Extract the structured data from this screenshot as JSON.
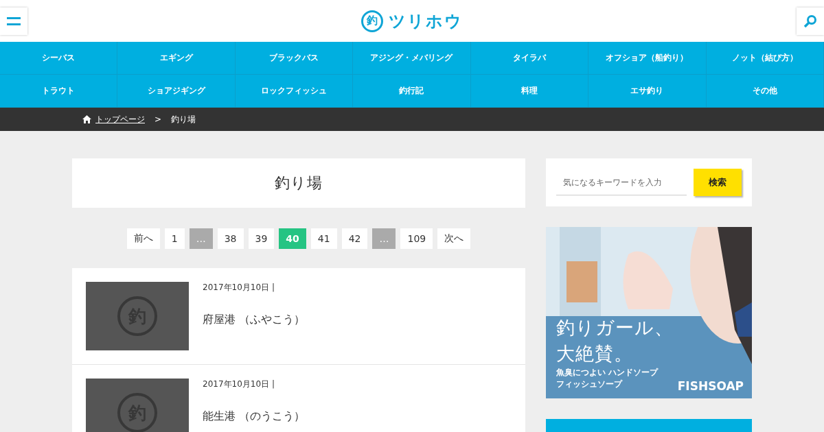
{
  "header": {
    "logo_mark": "釣",
    "logo_text": "ツリホウ"
  },
  "nav": [
    {
      "label": "シーバス"
    },
    {
      "label": "エギング"
    },
    {
      "label": "ブラックバス"
    },
    {
      "label": "アジング・メバリング"
    },
    {
      "label": "タイラバ"
    },
    {
      "label": "オフショア（船釣り）"
    },
    {
      "label": "ノット（結び方）"
    },
    {
      "label": "トラウト"
    },
    {
      "label": "ショアジギング"
    },
    {
      "label": "ロックフィッシュ"
    },
    {
      "label": "釣行記"
    },
    {
      "label": "料理"
    },
    {
      "label": "エサ釣り"
    },
    {
      "label": "その他"
    }
  ],
  "breadcrumb": {
    "home": "トップページ",
    "separator": ">",
    "current": "釣り場"
  },
  "page_title": "釣り場",
  "pagination": [
    {
      "label": "前へ",
      "kind": "page",
      "selected": false
    },
    {
      "label": "1",
      "kind": "page",
      "selected": false
    },
    {
      "label": "…",
      "kind": "gap",
      "selected": false
    },
    {
      "label": "38",
      "kind": "page",
      "selected": false
    },
    {
      "label": "39",
      "kind": "page",
      "selected": false
    },
    {
      "label": "40",
      "kind": "page",
      "selected": true
    },
    {
      "label": "41",
      "kind": "page",
      "selected": false
    },
    {
      "label": "42",
      "kind": "page",
      "selected": false
    },
    {
      "label": "…",
      "kind": "gap",
      "selected": false
    },
    {
      "label": "109",
      "kind": "page",
      "selected": false
    },
    {
      "label": "次へ",
      "kind": "page",
      "selected": false
    }
  ],
  "posts": [
    {
      "thumb_mark": "釣",
      "date": "2017年10月10日 |",
      "title": "府屋港 （ふやこう）"
    },
    {
      "thumb_mark": "釣",
      "date": "2017年10月10日 |",
      "title": "能生港 （のうこう）"
    }
  ],
  "search": {
    "placeholder": "気になるキーワードを入力",
    "button": "検索"
  },
  "banner": {
    "kind": "picture",
    "headline": [
      "釣りガール、",
      "大絶賛。"
    ],
    "sub": [
      "魚臭につよい ハンドソープ",
      "フィッシュソープ"
    ],
    "brand": "FISHSOAP"
  }
}
